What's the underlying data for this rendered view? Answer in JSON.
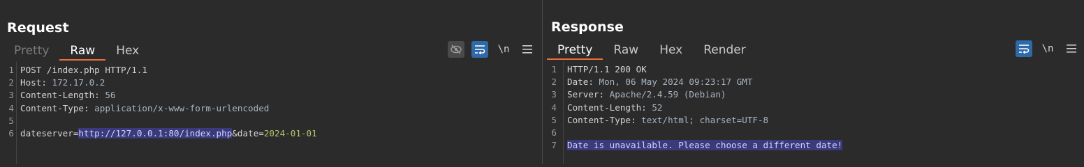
{
  "layout_switch": {
    "options": [
      "side-by-side",
      "stacked",
      "single"
    ],
    "active": "side-by-side"
  },
  "request": {
    "title": "Request",
    "tabs": [
      {
        "label": "Pretty",
        "state": "disabled"
      },
      {
        "label": "Raw",
        "state": "active"
      },
      {
        "label": "Hex",
        "state": "normal"
      }
    ],
    "toolbar": {
      "hide_icon": "eye-slash-icon",
      "wrap_icon": "word-wrap-icon",
      "newline_label": "\\n",
      "menu_icon": "hamburger-menu-icon"
    },
    "lines": [
      {
        "num": "1",
        "text": "POST /index.php HTTP/1.1"
      },
      {
        "num": "2",
        "key": "Host",
        "sep": ": ",
        "value": "172.17.0.2"
      },
      {
        "num": "3",
        "key": "Content-Length",
        "sep": ": ",
        "value": "56"
      },
      {
        "num": "4",
        "key": "Content-Type",
        "sep": ": ",
        "value": "application/x-www-form-urlencoded"
      },
      {
        "num": "5",
        "text": ""
      },
      {
        "num": "6",
        "body": {
          "p1": "dateserver",
          "eq1": "=",
          "v1": "http://127.0.0.1:80/index.php",
          "amp": "&",
          "p2": "date",
          "eq2": "=",
          "v2": "2024-01-01"
        }
      }
    ]
  },
  "response": {
    "title": "Response",
    "tabs": [
      {
        "label": "Pretty",
        "state": "active"
      },
      {
        "label": "Raw",
        "state": "normal"
      },
      {
        "label": "Hex",
        "state": "normal"
      },
      {
        "label": "Render",
        "state": "normal"
      }
    ],
    "toolbar": {
      "wrap_icon": "word-wrap-icon",
      "newline_label": "\\n",
      "menu_icon": "hamburger-menu-icon"
    },
    "lines": [
      {
        "num": "1",
        "text": "HTTP/1.1 200 OK"
      },
      {
        "num": "2",
        "key": "Date",
        "sep": ": ",
        "value": "Mon, 06 May 2024 09:23:17 GMT"
      },
      {
        "num": "3",
        "key": "Server",
        "sep": ": ",
        "value": "Apache/2.4.59 (Debian)"
      },
      {
        "num": "4",
        "key": "Content-Length",
        "sep": ": ",
        "value": "52"
      },
      {
        "num": "5",
        "key": "Content-Type",
        "sep": ": ",
        "value": "text/html; charset=UTF-8"
      },
      {
        "num": "6",
        "text": ""
      },
      {
        "num": "7",
        "text": "Date is unavailable. Please choose a different date!",
        "selected": true
      }
    ]
  },
  "colors": {
    "background": "#2b2b2b",
    "accent_tab": "#e8703a",
    "button_blue": "#2e6aa8",
    "selection": "#3a3a7c",
    "param_value": "#b5c46a"
  }
}
